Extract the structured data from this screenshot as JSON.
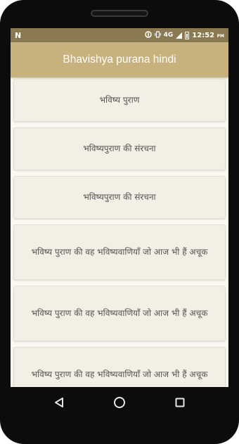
{
  "status_bar": {
    "left_icon": "N",
    "network": "4G",
    "time": "12:52",
    "time_suffix": "PM"
  },
  "app_bar": {
    "title": "Bhavishya purana hindi"
  },
  "items": [
    {
      "label": "भविष्य पुराण"
    },
    {
      "label": "भविष्यपुराण की संरचना"
    },
    {
      "label": "भविष्यपुराण की संरचना"
    },
    {
      "label": "भविष्य पुराण की वह भविष्यवाणियाँ जो आज भी हैं अचूक"
    },
    {
      "label": "भविष्य पुराण की वह भविष्यवाणियाँ जो आज भी हैं अचूक"
    },
    {
      "label": "भविष्य पुराण की वह भविष्यवाणियाँ जो आज भी हैं अचूक"
    }
  ],
  "nav_icons": [
    "back-icon",
    "home-icon",
    "recents-icon"
  ],
  "colors": {
    "app_bar": "#c7b17c",
    "status_bar": "#8b7a51",
    "card": "#f3efe5"
  }
}
